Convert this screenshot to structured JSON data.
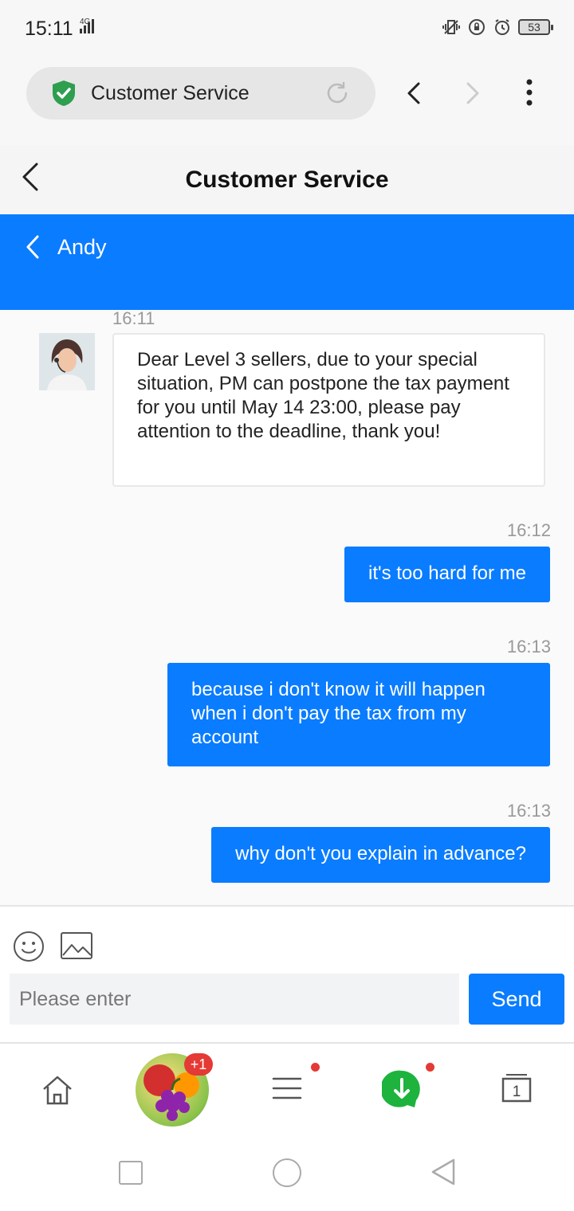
{
  "status_bar": {
    "time": "15:11",
    "network": "4G",
    "battery": "53"
  },
  "browser": {
    "url_title": "Customer Service"
  },
  "page": {
    "title": "Customer Service"
  },
  "chat_header": {
    "agent_name": "Andy"
  },
  "messages": [
    {
      "time": "16:11",
      "direction": "in",
      "text": "Dear Level 3 sellers, due to your special situation, PM can postpone the tax payment for you until May 14 23:00, please pay attention to the deadline, thank you!"
    },
    {
      "time": "16:12",
      "direction": "out",
      "text": "it's too hard for me"
    },
    {
      "time": "16:13",
      "direction": "out",
      "text": "because i don't know it will happen when i don't pay the tax from my account"
    },
    {
      "time": "16:13",
      "direction": "out",
      "text": "why don't you explain in advance?"
    }
  ],
  "composer": {
    "placeholder": "Please enter",
    "send_label": "Send"
  },
  "bottom_nav": {
    "game_badge": "+1",
    "tabs_count": "1"
  },
  "colors": {
    "accent": "#0a7cff",
    "badge": "#e53935",
    "shield": "#2e9e4f",
    "download": "#1db33c"
  }
}
